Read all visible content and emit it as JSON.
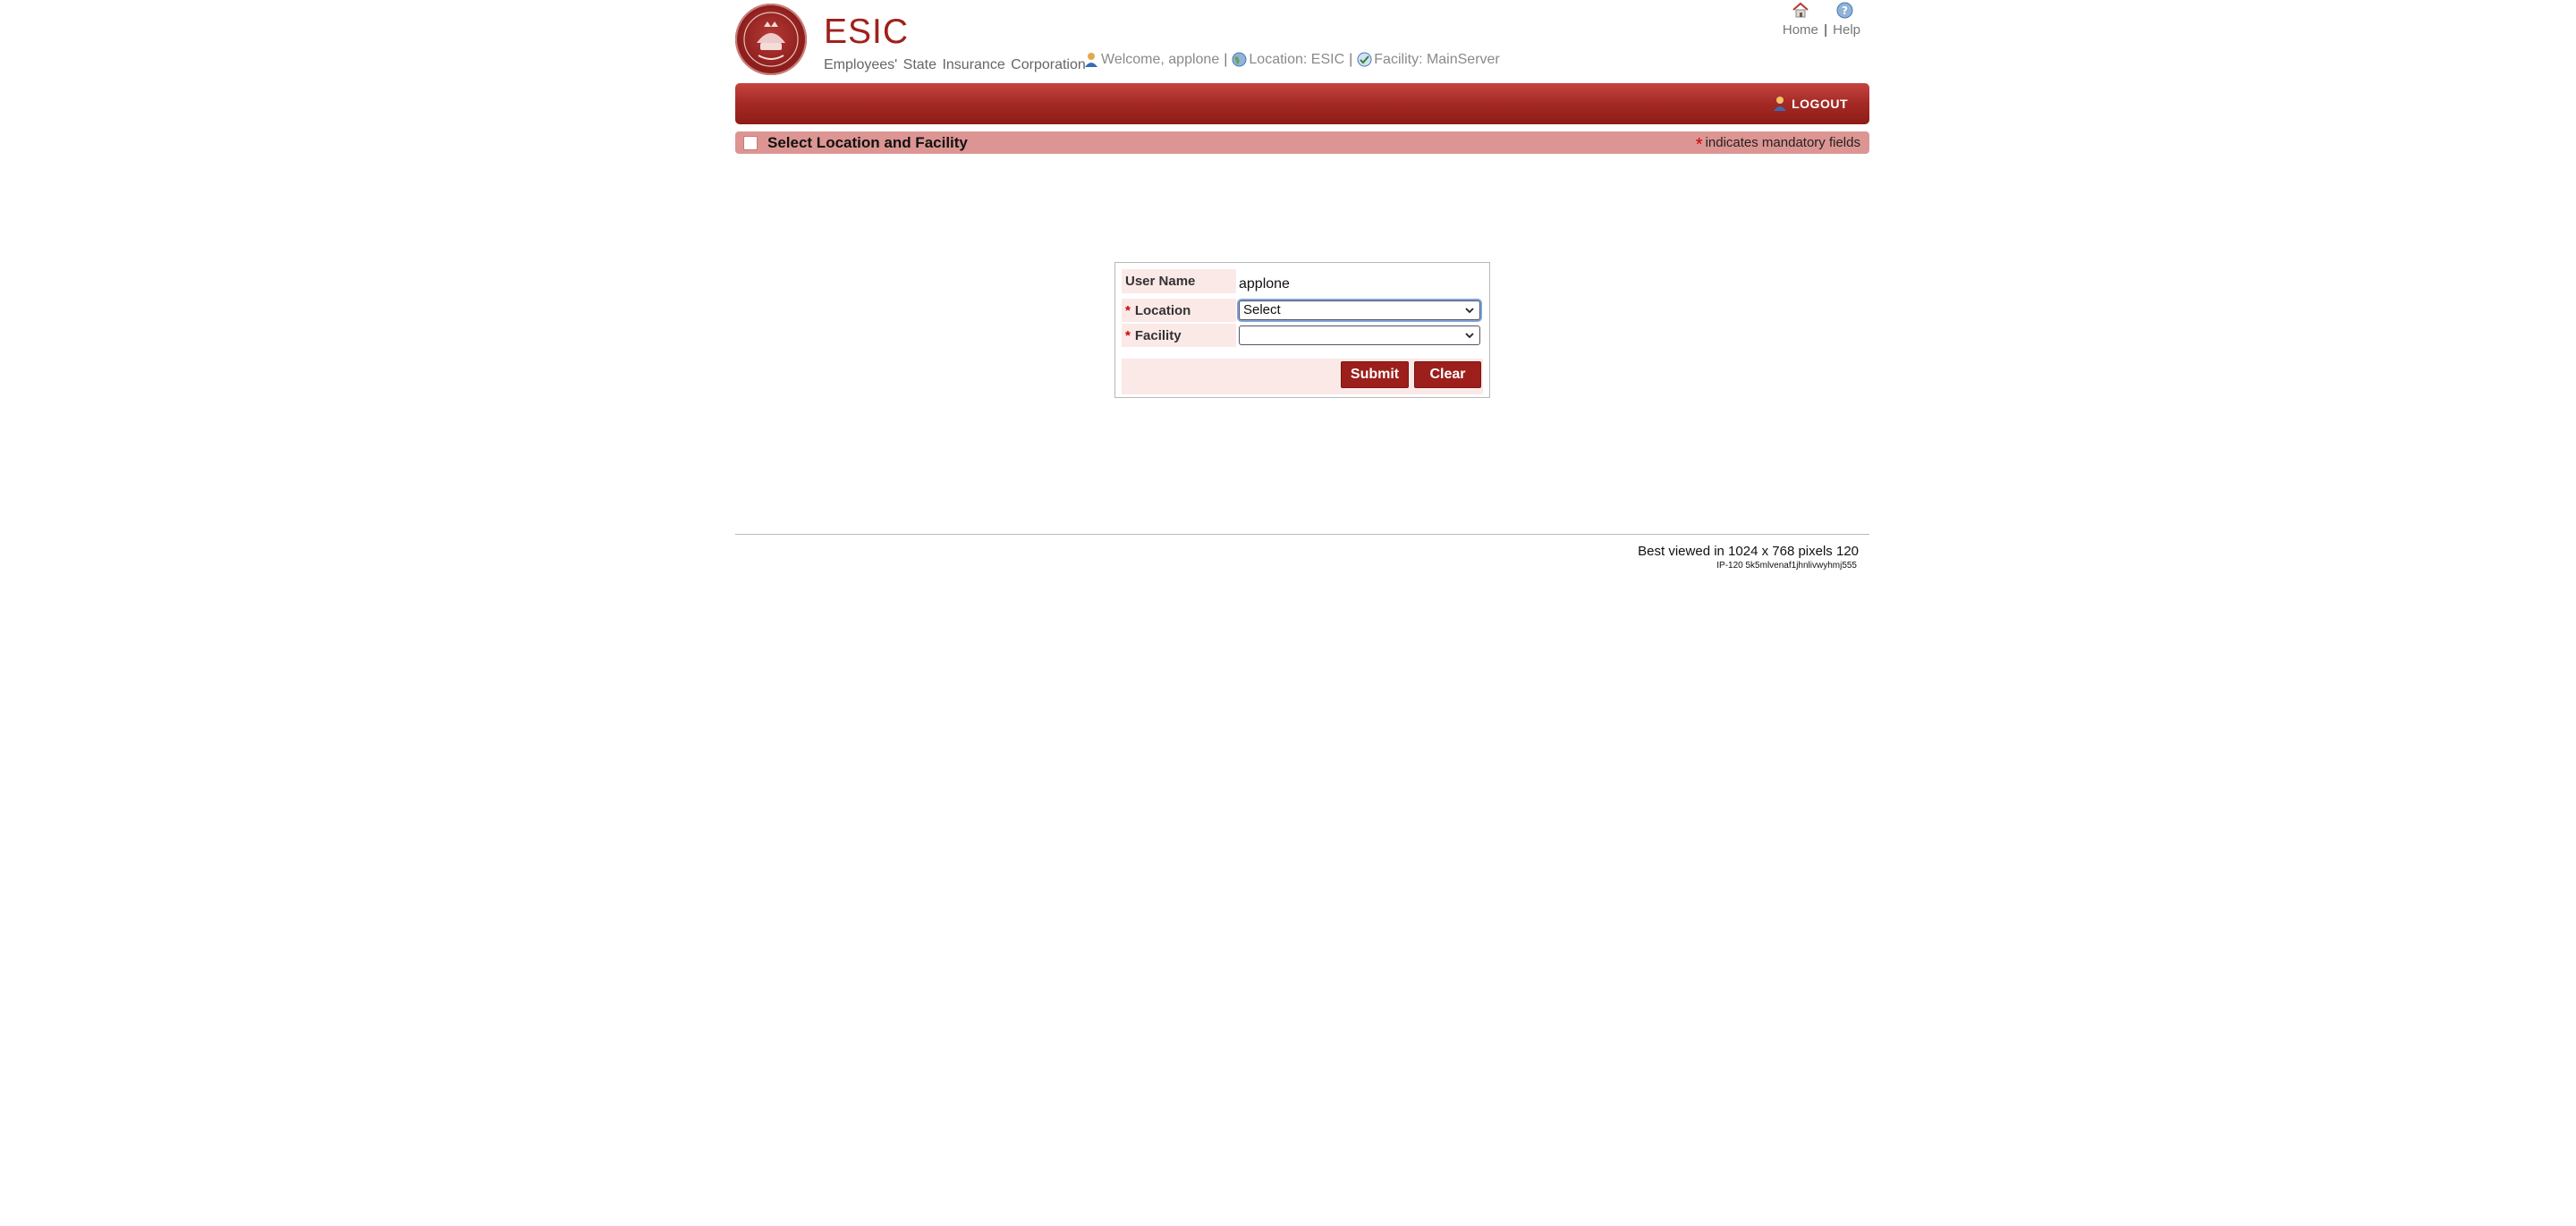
{
  "header": {
    "brand_title": "ESIC",
    "brand_subtitle": "Employees' State Insurance Corporation",
    "welcome": "Welcome, applone",
    "location": "Location: ESIC",
    "facility": "Facility: MainServer",
    "home_link": "Home",
    "help_link": "Help",
    "link_separator": "|"
  },
  "navbar": {
    "logout_label": "LOGOUT"
  },
  "section": {
    "title": "Select Location and Facility",
    "mandatory_star": "*",
    "mandatory_note": "indicates mandatory fields"
  },
  "form": {
    "username_label": "User Name",
    "username_value": "applone",
    "location_label": "Location",
    "location_selected": "Select",
    "facility_label": "Facility",
    "facility_selected": "",
    "required_marker": "*",
    "submit_label": "Submit",
    "clear_label": "Clear"
  },
  "footer": {
    "best_viewed": "Best viewed in 1024 x 768 pixels 120",
    "ip_info": "IP-120 5k5mlvenaf1jhnlivwyhmj555"
  },
  "colors": {
    "brand_red": "#a42925",
    "section_bg": "#dc9592",
    "label_bg": "#fbe9e8"
  },
  "icons": [
    "user-icon",
    "globe-icon",
    "facility-icon",
    "home-icon",
    "help-icon",
    "logout-icon",
    "chevron-down-icon"
  ]
}
